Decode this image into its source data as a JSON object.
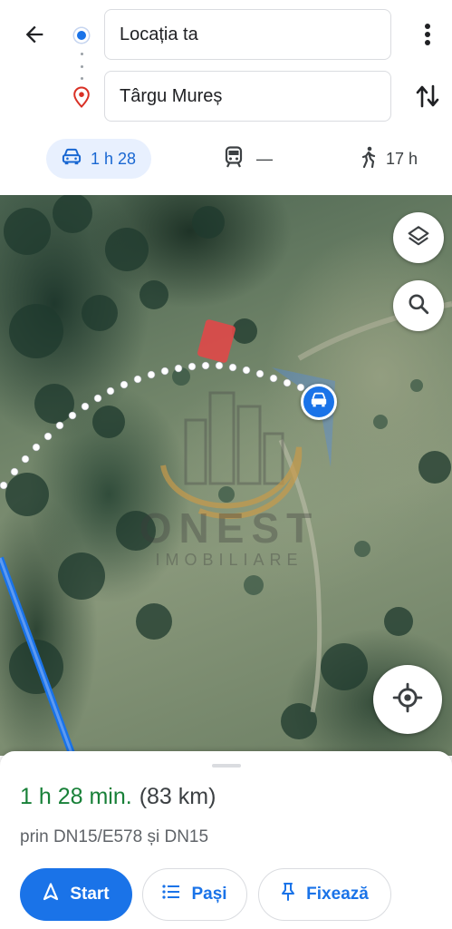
{
  "search": {
    "origin_value": "Locația ta",
    "destination_value": "Târgu Mureș"
  },
  "modes": [
    {
      "icon": "car-icon",
      "label": "1 h 28",
      "selected": true
    },
    {
      "icon": "train-icon",
      "label": "—",
      "selected": false
    },
    {
      "icon": "walk-icon",
      "label": "17 h",
      "selected": false
    }
  ],
  "map": {
    "type": "satellite",
    "watermark": {
      "name": "ONEST",
      "subtitle": "IMOBILIARE"
    },
    "buttons": [
      "layers-icon",
      "search-icon",
      "my-location-icon"
    ]
  },
  "route": {
    "duration": "1 h 28 min.",
    "distance": "(83 km)",
    "via": "prin DN15/E578 și DN15"
  },
  "actions": {
    "start": "Start",
    "steps": "Pași",
    "pin": "Fixează"
  },
  "colors": {
    "accent": "#1a73e8",
    "duration_green": "#188038",
    "selected_mode_bg": "#e8f0fe"
  }
}
